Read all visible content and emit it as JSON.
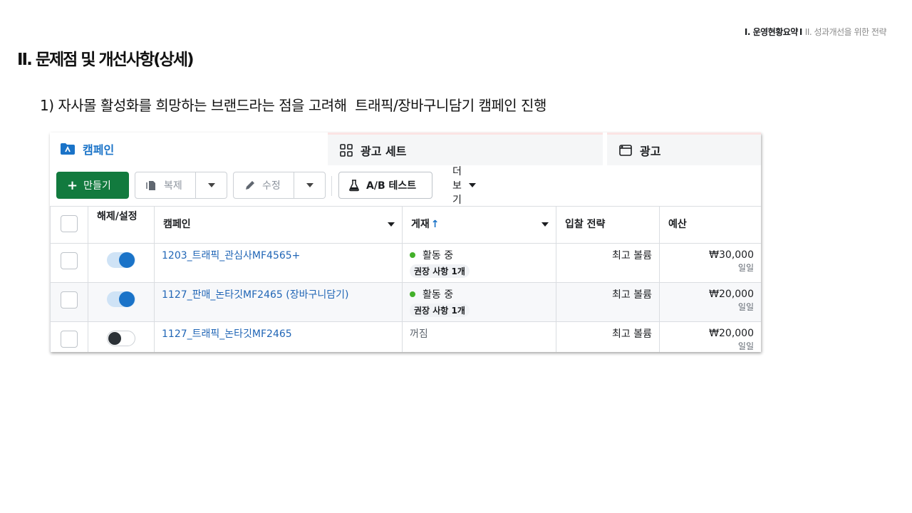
{
  "breadcrumb": {
    "active": "I. 운영현황요약",
    "separator": "I",
    "rest": "II. 성과개선을 위한 전략"
  },
  "page_title": "II. 문제점 및 개선사항(상세)",
  "subtitle": "1) 자사몰 활성화를 희망하는 브랜드라는 점을 고려해  트래픽/장바구니담기 캠페인 진행",
  "tabs": {
    "campaign": {
      "label": "캠페인",
      "icon": "folder-icon"
    },
    "adset": {
      "label": "광고 세트",
      "icon": "grid-icon"
    },
    "ad": {
      "label": "광고",
      "icon": "window-icon"
    }
  },
  "toolbar": {
    "create": "만들기",
    "duplicate": "복제",
    "edit": "수정",
    "ab_test": "A/B 테스트",
    "more": "더 보기"
  },
  "columns": {
    "toggle": "해제/설정",
    "campaign": "캠페인",
    "delivery": "게재",
    "bid": "입찰 전략",
    "budget": "예산"
  },
  "rows": [
    {
      "on": true,
      "name": "1203_트래픽_관심사MF4565+",
      "status": "활동 중",
      "recommendation": "권장 사항 1개",
      "bid": "최고 볼륨",
      "budget": "₩30,000",
      "period": "일일"
    },
    {
      "on": true,
      "name": "1127_판매_논타깃MF2465 (장바구니담기)",
      "status": "활동 중",
      "recommendation": "권장 사항 1개",
      "bid": "최고 볼륨",
      "budget": "₩20,000",
      "period": "일일"
    },
    {
      "on": false,
      "name": "1127_트래픽_논타깃MF2465",
      "status": "꺼짐",
      "recommendation": "",
      "bid": "최고 볼륨",
      "budget": "₩20,000",
      "period": "일일"
    }
  ],
  "colors": {
    "create_button": "#127a3e",
    "link": "#2166b6",
    "toggle_on": "#1a73c8",
    "active_dot": "#43b02a"
  }
}
